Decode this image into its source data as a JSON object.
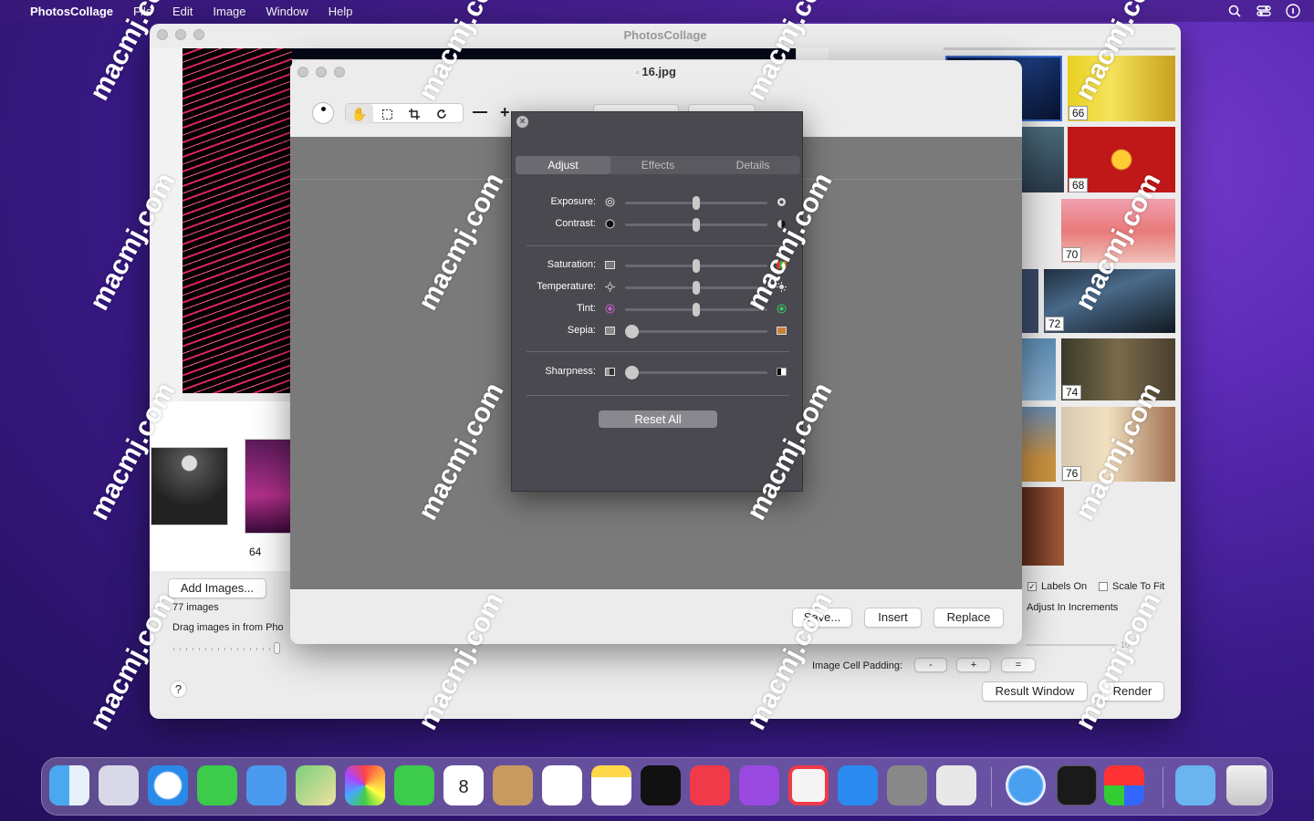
{
  "menubar": {
    "app": "PhotosCollage",
    "items": [
      "File",
      "Edit",
      "Image",
      "Window",
      "Help"
    ]
  },
  "main": {
    "title": "PhotosCollage",
    "thumb_label": "64",
    "add_images": "Add Images...",
    "count": "77 images",
    "drag_hint": "Drag images in from Pho",
    "labels_on": "Labels On",
    "scale_fit": "Scale To Fit",
    "adjust_inc": "Adjust In Increments",
    "cell_padding": "Image Cell Padding:",
    "minus": "-",
    "plus": "+",
    "equal": "=",
    "result_window": "Result Window",
    "render": "Render",
    "help": "?",
    "slider_val": "10"
  },
  "right_thumbs": [
    "66",
    "68",
    "70",
    "72",
    "74",
    "76"
  ],
  "editor": {
    "title": "16.jpg",
    "save": "Save...",
    "insert": "Insert",
    "replace": "Replace"
  },
  "adjust": {
    "tabs": [
      "Adjust",
      "Effects",
      "Details"
    ],
    "rows": [
      {
        "label": "Exposure:",
        "value": 0.5
      },
      {
        "label": "Contrast:",
        "value": 0.5
      },
      {
        "label": "Saturation:",
        "value": 0.5
      },
      {
        "label": "Temperature:",
        "value": 0.5
      },
      {
        "label": "Tint:",
        "value": 0.5
      },
      {
        "label": "Sepia:",
        "value": 0.0
      },
      {
        "label": "Sharpness:",
        "value": 0.0
      }
    ],
    "reset": "Reset All"
  },
  "watermark": "macmj.com",
  "colors": {
    "accent": "#5d2bb8",
    "panel": "#4b4950"
  }
}
